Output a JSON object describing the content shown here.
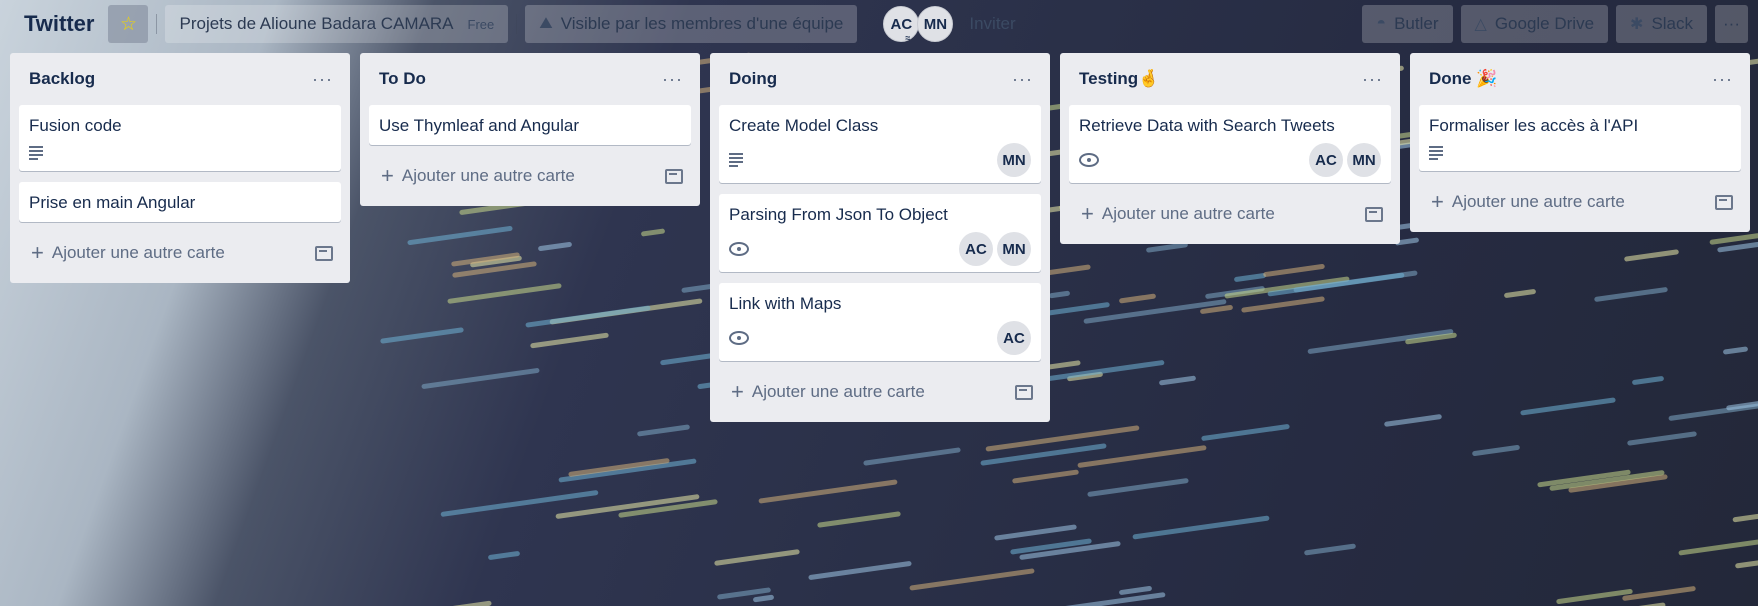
{
  "board": {
    "title": "Twitter",
    "team": "Projets de Alioune Badara CAMARA",
    "plan": "Free",
    "visibility": "Visible par les membres d'une équipe",
    "members": [
      "AC",
      "MN"
    ],
    "invite_label": "Inviter",
    "powerups": [
      "Butler",
      "Google Drive",
      "Slack"
    ]
  },
  "add_card_label": "Ajouter une autre carte",
  "lists": [
    {
      "title": "Backlog",
      "cards": [
        {
          "title": "Fusion code",
          "badge": "description",
          "members": []
        },
        {
          "title": "Prise en main Angular",
          "badge": "",
          "members": []
        }
      ]
    },
    {
      "title": "To Do",
      "cards": [
        {
          "title": "Use Thymleaf and Angular",
          "badge": "",
          "members": []
        }
      ]
    },
    {
      "title": "Doing",
      "cards": [
        {
          "title": "Create Model Class",
          "badge": "description",
          "members": [
            "MN"
          ]
        },
        {
          "title": "Parsing From Json To Object",
          "badge": "watch",
          "members": [
            "AC",
            "MN"
          ]
        },
        {
          "title": "Link with Maps",
          "badge": "watch",
          "members": [
            "AC"
          ]
        }
      ]
    },
    {
      "title": "Testing🤞",
      "cards": [
        {
          "title": "Retrieve Data with Search Tweets",
          "badge": "watch",
          "members": [
            "AC",
            "MN"
          ]
        }
      ]
    },
    {
      "title": "Done 🎉",
      "cards": [
        {
          "title": "Formaliser les accès à l'API",
          "badge": "description",
          "members": []
        }
      ]
    }
  ],
  "colors": {
    "list_bg": "#ebecf0",
    "card_bg": "#ffffff",
    "text": "#172b4d",
    "muted": "#5e6c84",
    "star": "#f2d600"
  }
}
